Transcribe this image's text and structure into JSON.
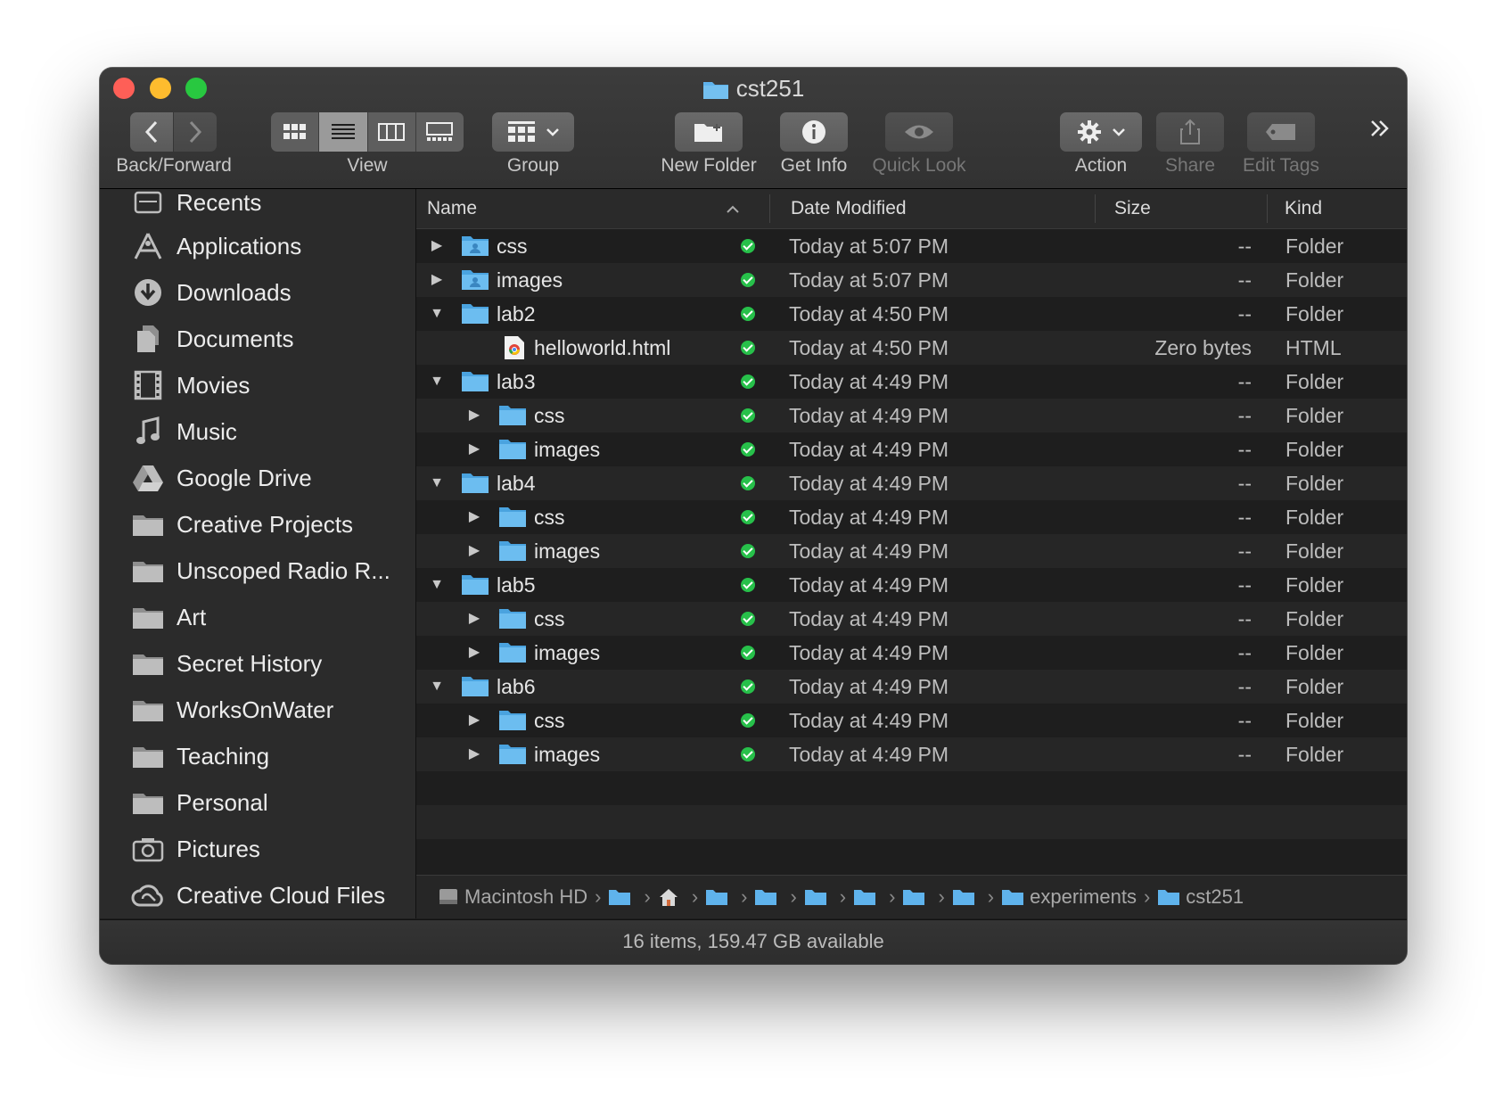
{
  "window": {
    "title": "cst251"
  },
  "toolbar": {
    "back_forward_label": "Back/Forward",
    "view_label": "View",
    "group_label": "Group",
    "new_folder_label": "New Folder",
    "get_info_label": "Get Info",
    "quick_look_label": "Quick Look",
    "action_label": "Action",
    "share_label": "Share",
    "edit_tags_label": "Edit Tags",
    "overflow_icon": "chevron-double-right-icon"
  },
  "sidebar": {
    "items": [
      {
        "label": "Recents",
        "icon": "recents-icon"
      },
      {
        "label": "Applications",
        "icon": "applications-icon"
      },
      {
        "label": "Downloads",
        "icon": "downloads-icon"
      },
      {
        "label": "Documents",
        "icon": "documents-icon"
      },
      {
        "label": "Movies",
        "icon": "movies-icon"
      },
      {
        "label": "Music",
        "icon": "music-icon"
      },
      {
        "label": "Google Drive",
        "icon": "google-drive-icon"
      },
      {
        "label": "Creative Projects",
        "icon": "folder-icon"
      },
      {
        "label": "Unscoped Radio R...",
        "icon": "folder-icon"
      },
      {
        "label": "Art",
        "icon": "folder-icon"
      },
      {
        "label": "Secret History",
        "icon": "folder-icon"
      },
      {
        "label": "WorksOnWater",
        "icon": "folder-icon"
      },
      {
        "label": "Teaching",
        "icon": "folder-icon"
      },
      {
        "label": "Personal",
        "icon": "folder-icon"
      },
      {
        "label": "Pictures",
        "icon": "pictures-icon"
      },
      {
        "label": "Creative Cloud Files",
        "icon": "creative-cloud-icon"
      }
    ]
  },
  "columns": {
    "name": "Name",
    "date": "Date Modified",
    "size": "Size",
    "kind": "Kind"
  },
  "rows": [
    {
      "name": "css",
      "date": "Today at 5:07 PM",
      "size": "--",
      "kind": "Folder"
    },
    {
      "name": "images",
      "date": "Today at 5:07 PM",
      "size": "--",
      "kind": "Folder"
    },
    {
      "name": "lab2",
      "date": "Today at 4:50 PM",
      "size": "--",
      "kind": "Folder"
    },
    {
      "name": "helloworld.html",
      "date": "Today at 4:50 PM",
      "size": "Zero bytes",
      "kind": "HTML"
    },
    {
      "name": "lab3",
      "date": "Today at 4:49 PM",
      "size": "--",
      "kind": "Folder"
    },
    {
      "name": "css",
      "date": "Today at 4:49 PM",
      "size": "--",
      "kind": "Folder"
    },
    {
      "name": "images",
      "date": "Today at 4:49 PM",
      "size": "--",
      "kind": "Folder"
    },
    {
      "name": "lab4",
      "date": "Today at 4:49 PM",
      "size": "--",
      "kind": "Folder"
    },
    {
      "name": "css",
      "date": "Today at 4:49 PM",
      "size": "--",
      "kind": "Folder"
    },
    {
      "name": "images",
      "date": "Today at 4:49 PM",
      "size": "--",
      "kind": "Folder"
    },
    {
      "name": "lab5",
      "date": "Today at 4:49 PM",
      "size": "--",
      "kind": "Folder"
    },
    {
      "name": "css",
      "date": "Today at 4:49 PM",
      "size": "--",
      "kind": "Folder"
    },
    {
      "name": "images",
      "date": "Today at 4:49 PM",
      "size": "--",
      "kind": "Folder"
    },
    {
      "name": "lab6",
      "date": "Today at 4:49 PM",
      "size": "--",
      "kind": "Folder"
    },
    {
      "name": "css",
      "date": "Today at 4:49 PM",
      "size": "--",
      "kind": "Folder"
    },
    {
      "name": "images",
      "date": "Today at 4:49 PM",
      "size": "--",
      "kind": "Folder"
    }
  ],
  "pathbar": {
    "first": "Macintosh HD",
    "experiments": "experiments",
    "last": "cst251"
  },
  "status": {
    "text": "16 items, 159.47 GB available"
  },
  "colors": {
    "folder": "#5fb3ec",
    "check": "#27c04a",
    "close": "#fe5f57",
    "minimize": "#febc2e",
    "maximize": "#28c840"
  }
}
